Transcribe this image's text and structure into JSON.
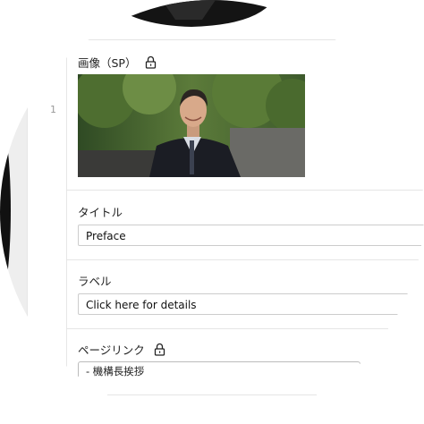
{
  "row": {
    "number": "1"
  },
  "fields": {
    "image_sp": {
      "label": "画像（SP）",
      "locked": true
    },
    "title": {
      "label": "タイトル",
      "value": "Preface"
    },
    "label": {
      "label": "ラベル",
      "value": "Click here for details"
    },
    "page_link": {
      "label": "ページリンク",
      "locked": true,
      "selected": "- 機構長挨拶"
    }
  },
  "icons": {
    "lock": "lock-icon"
  },
  "colors": {
    "border": "#cccccc",
    "divider": "#e5e5e5",
    "gutter": "#eeeeee",
    "text": "#222222",
    "muted": "#999999"
  }
}
